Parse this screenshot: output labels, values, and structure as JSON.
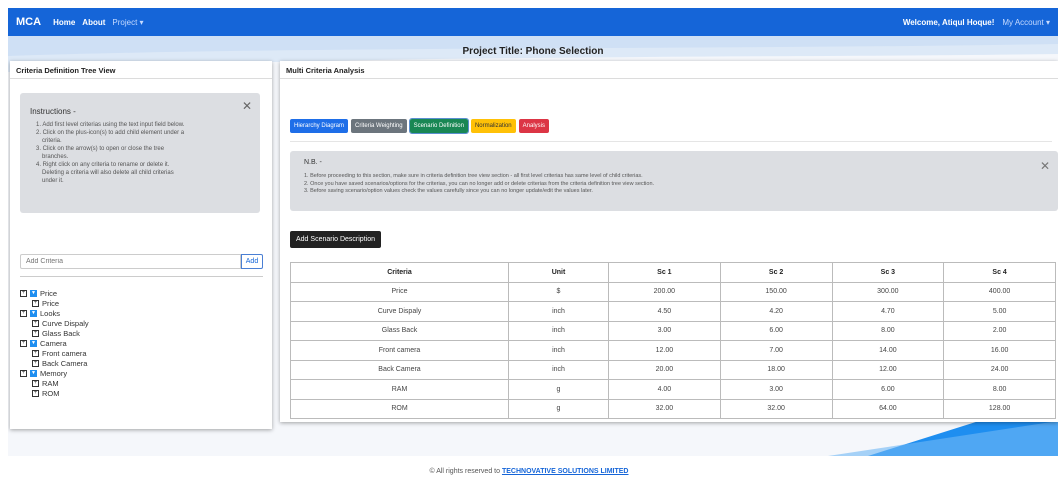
{
  "nav": {
    "brand": "MCA",
    "home": "Home",
    "about": "About",
    "project": "Project",
    "welcome": "Welcome, Atiqul Hoque!",
    "account": "My Account"
  },
  "project_title": "Project Title: Phone Selection",
  "left_panel": {
    "title": "Criteria Definition Tree View",
    "instructions_title": "Instructions -",
    "instructions": [
      "1. Add first level criterias using the text input field below.",
      "2. Click on the plus-icon(s) to add child element under a",
      "criteria.",
      "3. Click on the arrow(s) to open or close the tree",
      "branches.",
      "4. Right click on any criteria to rename or delete it.",
      "Deleting a criteria will also delete all child criterias",
      "under it."
    ],
    "criteria_placeholder": "Add Criteria",
    "add_label": "Add",
    "tree": [
      {
        "label": "Price",
        "children": [
          "Price"
        ]
      },
      {
        "label": "Looks",
        "children": [
          "Curve Dispaly",
          "Glass Back"
        ]
      },
      {
        "label": "Camera",
        "children": [
          "Front camera",
          "Back Camera"
        ]
      },
      {
        "label": "Memory",
        "children": [
          "RAM",
          "ROM"
        ]
      }
    ]
  },
  "right_panel": {
    "title": "Multi Criteria Analysis",
    "tabs": [
      "Hierarchy Diagram",
      "Criteria Weighting",
      "Scenario Definition",
      "Normalization",
      "Analysis"
    ],
    "nb_title": "N.B. -",
    "nb_items": [
      "1. Before proceeding to this section, make sure in criteria definition tree view section - all first level criterias has same level of child criterias.",
      "2. Once you have saved scenarios/options for the criterias, you can no longer add or delete criterias from the criteria definition tree view section.",
      "3. Before saving scenario/option values check the values carefully since you can no longer update/edit the values later."
    ],
    "add_scenario_label": "Add Scenario Description",
    "table": {
      "headers": [
        "Criteria",
        "Unit",
        "Sc 1",
        "Sc 2",
        "Sc 3",
        "Sc 4"
      ],
      "rows": [
        [
          "Price",
          "$",
          "200.00",
          "150.00",
          "300.00",
          "400.00"
        ],
        [
          "Curve Dispaly",
          "inch",
          "4.50",
          "4.20",
          "4.70",
          "5.00"
        ],
        [
          "Glass Back",
          "inch",
          "3.00",
          "6.00",
          "8.00",
          "2.00"
        ],
        [
          "Front camera",
          "inch",
          "12.00",
          "7.00",
          "14.00",
          "16.00"
        ],
        [
          "Back Camera",
          "inch",
          "20.00",
          "18.00",
          "12.00",
          "24.00"
        ],
        [
          "RAM",
          "g",
          "4.00",
          "3.00",
          "6.00",
          "8.00"
        ],
        [
          "ROM",
          "g",
          "32.00",
          "32.00",
          "64.00",
          "128.00"
        ]
      ]
    }
  },
  "footer": {
    "text": "© All rights reserved to",
    "company": "TECHNOVATIVE SOLUTIONS LIMITED"
  }
}
